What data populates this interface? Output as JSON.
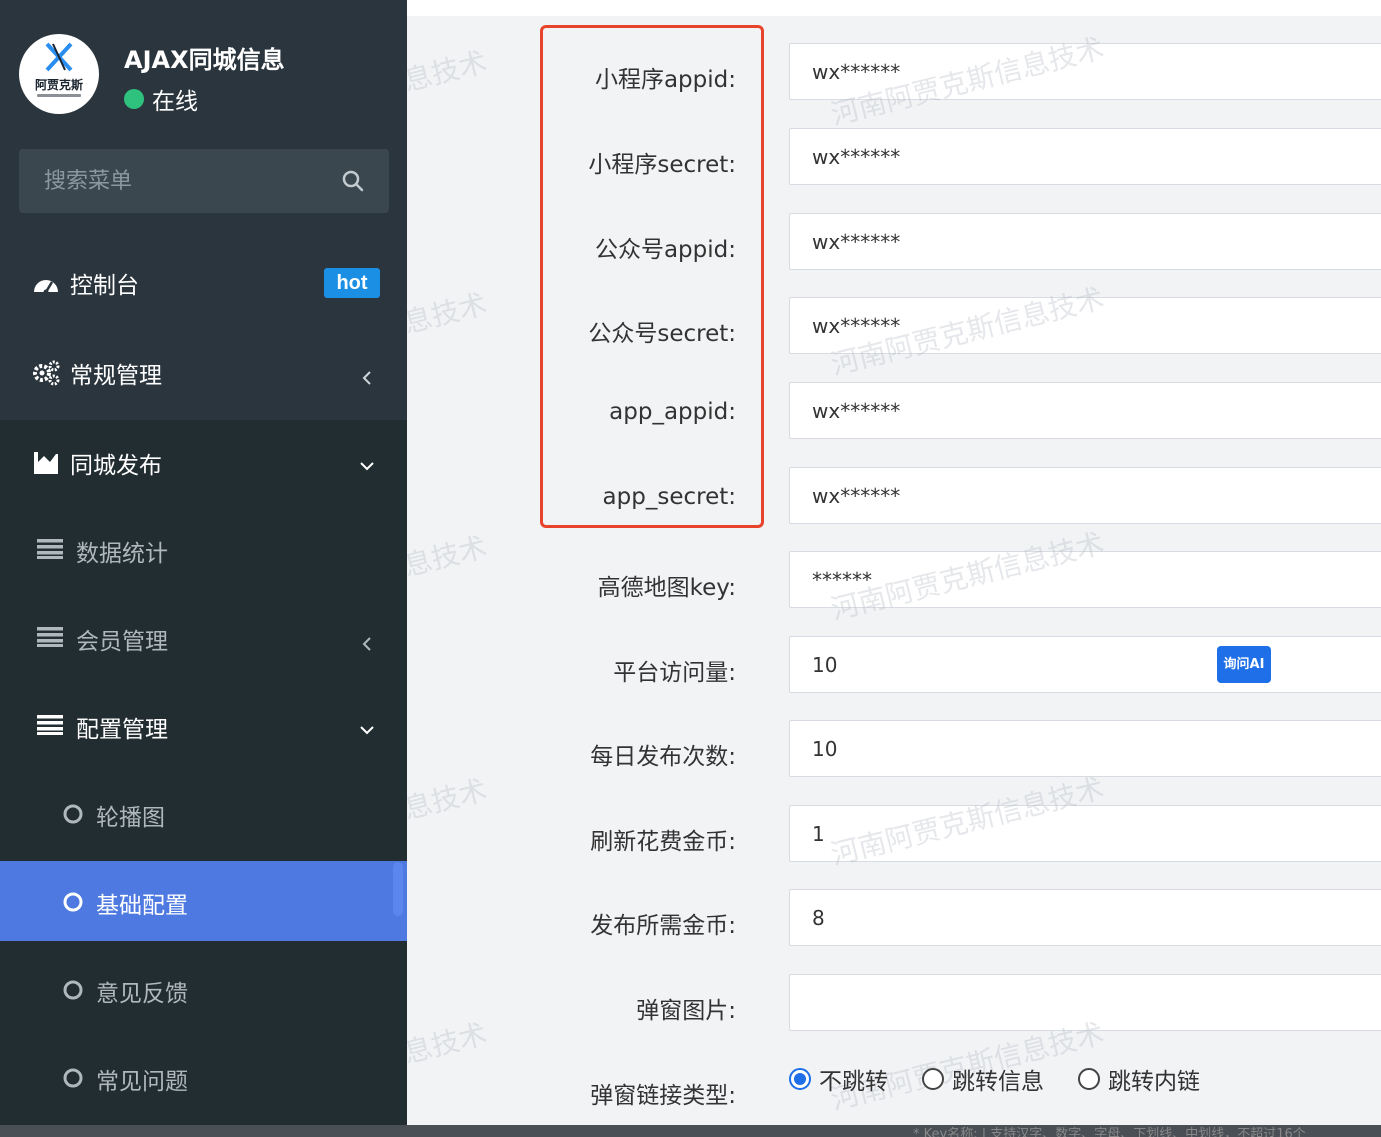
{
  "app": {
    "title": "AJAX同城信息",
    "status": "在线",
    "logo_text": "阿贾克斯",
    "status_color": "#2ec27e"
  },
  "search": {
    "placeholder": "搜索菜单"
  },
  "sidebar": {
    "items": [
      {
        "label": "控制台",
        "icon": "dashboard-icon",
        "badge": "hot"
      },
      {
        "label": "常规管理",
        "icon": "gears-icon"
      },
      {
        "label": "同城发布",
        "icon": "area-chart-icon"
      },
      {
        "label": "数据统计",
        "icon": "list-icon"
      },
      {
        "label": "会员管理",
        "icon": "list-icon"
      },
      {
        "label": "配置管理",
        "icon": "list-icon"
      },
      {
        "label": "轮播图",
        "icon": "circle-icon"
      },
      {
        "label": "基础配置",
        "icon": "circle-icon",
        "active": true
      },
      {
        "label": "意见反馈",
        "icon": "circle-icon"
      },
      {
        "label": "常见问题",
        "icon": "circle-icon"
      }
    ],
    "active_color": "#4e79e0"
  },
  "form": {
    "fields": [
      {
        "label": "小程序appid:",
        "value": "wx******"
      },
      {
        "label": "小程序secret:",
        "value": "wx******"
      },
      {
        "label": "公众号appid:",
        "value": "wx******"
      },
      {
        "label": "公众号secret:",
        "value": "wx******"
      },
      {
        "label": "app_appid:",
        "value": "wx******"
      },
      {
        "label": "app_secret:",
        "value": "wx******"
      },
      {
        "label": "高德地图key:",
        "value": "******"
      },
      {
        "label": "平台访问量:",
        "value": "10"
      },
      {
        "label": "每日发布次数:",
        "value": "10"
      },
      {
        "label": "刷新花费金币:",
        "value": "1"
      },
      {
        "label": "发布所需金币:",
        "value": "8"
      },
      {
        "label": "弹窗图片:",
        "value": ""
      }
    ],
    "radio_label": "弹窗链接类型:",
    "radio_options": [
      "不跳转",
      "跳转信息",
      "跳转内链"
    ],
    "radio_selected": "不跳转",
    "ai_button": "询问AI",
    "highlight_color": "#e8432b"
  },
  "watermark": {
    "text": "河南阿贾克斯信息技术",
    "side_text": "息技术"
  },
  "bottom_hint": "* Key名称: | 支持汉字、数字、字母、下划线、中划线，不超过16个"
}
